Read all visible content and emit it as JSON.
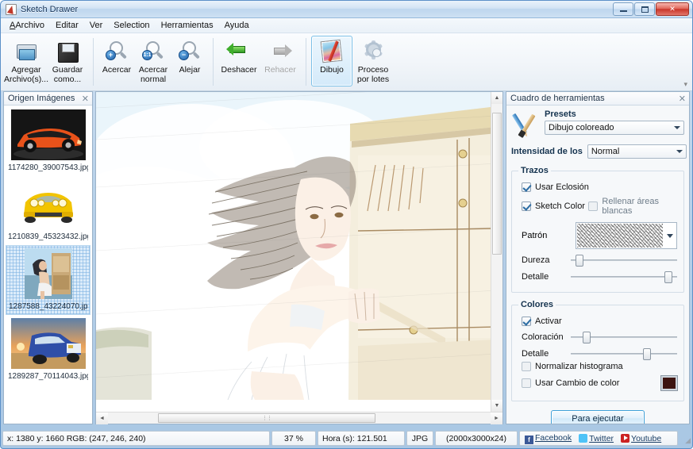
{
  "window": {
    "title": "Sketch Drawer",
    "icon": "app-icon",
    "minimize": "–",
    "maximize": "□",
    "close": "✕"
  },
  "menu": {
    "items": [
      {
        "label": "Archivo",
        "accel": "A"
      },
      {
        "label": "Editar",
        "accel": "E"
      },
      {
        "label": "Ver",
        "accel": "V"
      },
      {
        "label": "Selection",
        "accel": "S"
      },
      {
        "label": "Herramientas",
        "accel": "H"
      },
      {
        "label": "Ayuda",
        "accel": "A"
      }
    ]
  },
  "toolbar": {
    "add_files": "Agregar Archivo(s)...",
    "save_as": "Guardar como...",
    "zoom_in": "Acercar",
    "zoom_normal": "Acercar normal",
    "zoom_out": "Alejar",
    "undo": "Deshacer",
    "redo": "Rehacer",
    "draw": "Dibujo",
    "batch": "Proceso por lotes",
    "overflow": "▾"
  },
  "source_panel": {
    "title": "Origen Imágenes",
    "close": "✕",
    "items": [
      {
        "name": "1174280_39007543.jpg",
        "selected": false,
        "kind": "orange-sports-car"
      },
      {
        "name": "1210839_45323432.jpg",
        "selected": false,
        "kind": "yellow-coupe-car"
      },
      {
        "name": "1287588_43224070.jpg",
        "selected": true,
        "kind": "woman-portrait"
      },
      {
        "name": "1289287_70114043.jpg",
        "selected": false,
        "kind": "blue-pickup-truck"
      }
    ]
  },
  "canvas": {
    "alt": "sketch-rendered photo of a woman leaning on a wooden machine with clouds behind",
    "vscroll_thumb_top_pct": 3,
    "vscroll_thumb_height_pct": 48,
    "hscroll_thumb_left_pct": 13,
    "hscroll_thumb_width_pct": 57,
    "grip": "⋮⋮",
    "up_arrow": "▲",
    "down_arrow": "▼",
    "left_arrow": "◄",
    "right_arrow": "►"
  },
  "tools_panel": {
    "title": "Cuadro de herramientas",
    "close": "✕",
    "presets_label": "Presets",
    "presets_value": "Dibujo coloreado",
    "intensity_label": "Intensidad de los",
    "intensity_value": "Normal",
    "strokes": {
      "legend": "Trazos",
      "use_hatching": {
        "label": "Usar Eclosión",
        "checked": true
      },
      "sketch_color": {
        "label": "Sketch Color",
        "checked": true
      },
      "fill_white": {
        "label": "Rellenar áreas blancas",
        "checked": false
      },
      "pattern_label": "Patrón",
      "hardness_label": "Dureza",
      "hardness_value": 5,
      "detail_label": "Detalle",
      "detail_value": 95
    },
    "colors": {
      "legend": "Colores",
      "activate": {
        "label": "Activar",
        "checked": true
      },
      "coloration_label": "Coloración",
      "coloration_value": 12,
      "detail_label": "Detalle",
      "detail_value": 73,
      "normalize_histogram": {
        "label": "Normalizar histograma",
        "checked": false
      },
      "use_color_change": {
        "label": "Usar Cambio de color",
        "checked": false
      },
      "color_swatch": "#3d1410"
    },
    "run_button": "Para ejecutar"
  },
  "statusbar": {
    "cursor": "x: 1380 y: 1660  RGB: (247, 246, 240)",
    "zoom": "37 %",
    "time": "Hora (s): 121.501",
    "format": "JPG",
    "dimensions": "(2000x3000x24)",
    "facebook": "Facebook",
    "twitter": "Twitter",
    "youtube": "Youtube",
    "resize_grip": "◢"
  },
  "theme": {
    "accent": "#3fa0d8",
    "title_blue": "#18375c",
    "panel_bg": "#f6f8fa"
  }
}
